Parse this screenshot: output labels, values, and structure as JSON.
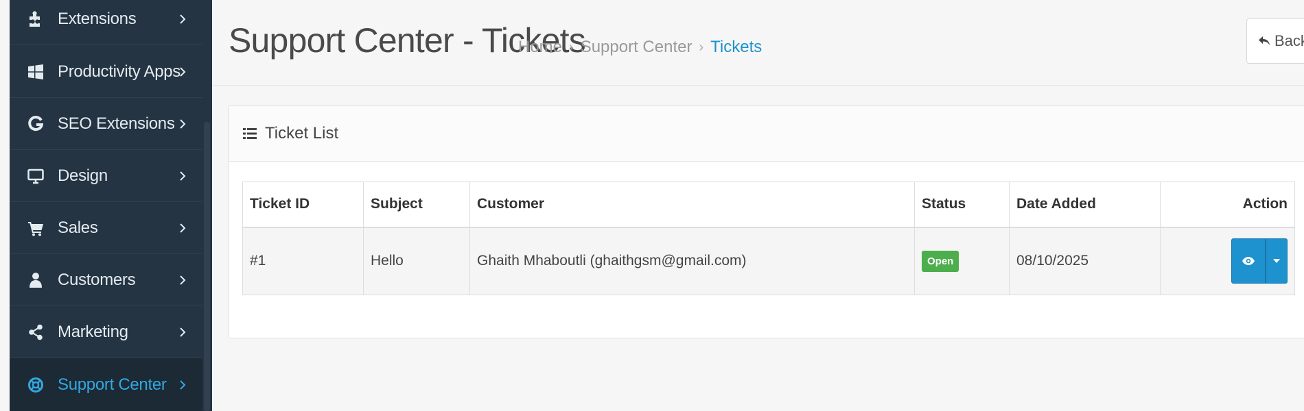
{
  "sidebar": {
    "items": [
      {
        "label": "Extensions",
        "icon": "puzzle-icon"
      },
      {
        "label": "Productivity Apps",
        "icon": "windows-icon"
      },
      {
        "label": "SEO Extensions",
        "icon": "google-icon"
      },
      {
        "label": "Design",
        "icon": "monitor-icon"
      },
      {
        "label": "Sales",
        "icon": "cart-icon"
      },
      {
        "label": "Customers",
        "icon": "user-icon"
      },
      {
        "label": "Marketing",
        "icon": "share-icon"
      },
      {
        "label": "Support Center",
        "icon": "lifebuoy-icon",
        "active": true
      }
    ]
  },
  "header": {
    "title": "Support Center - Tickets",
    "breadcrumb": [
      "Home",
      "Support Center",
      "Tickets"
    ],
    "back_label": "Back"
  },
  "panel": {
    "title": "Ticket List",
    "columns": [
      "Ticket ID",
      "Subject",
      "Customer",
      "Status",
      "Date Added",
      "Action"
    ],
    "rows": [
      {
        "id": "#1",
        "subject": "Hello",
        "customer": "Ghaith Mhaboutli (ghaithgsm@gmail.com)",
        "status": "Open",
        "date": "08/10/2025"
      }
    ]
  },
  "colors": {
    "sidebar_bg": "#243442",
    "accent": "#1e91cf",
    "status_open": "#4cae4c"
  }
}
